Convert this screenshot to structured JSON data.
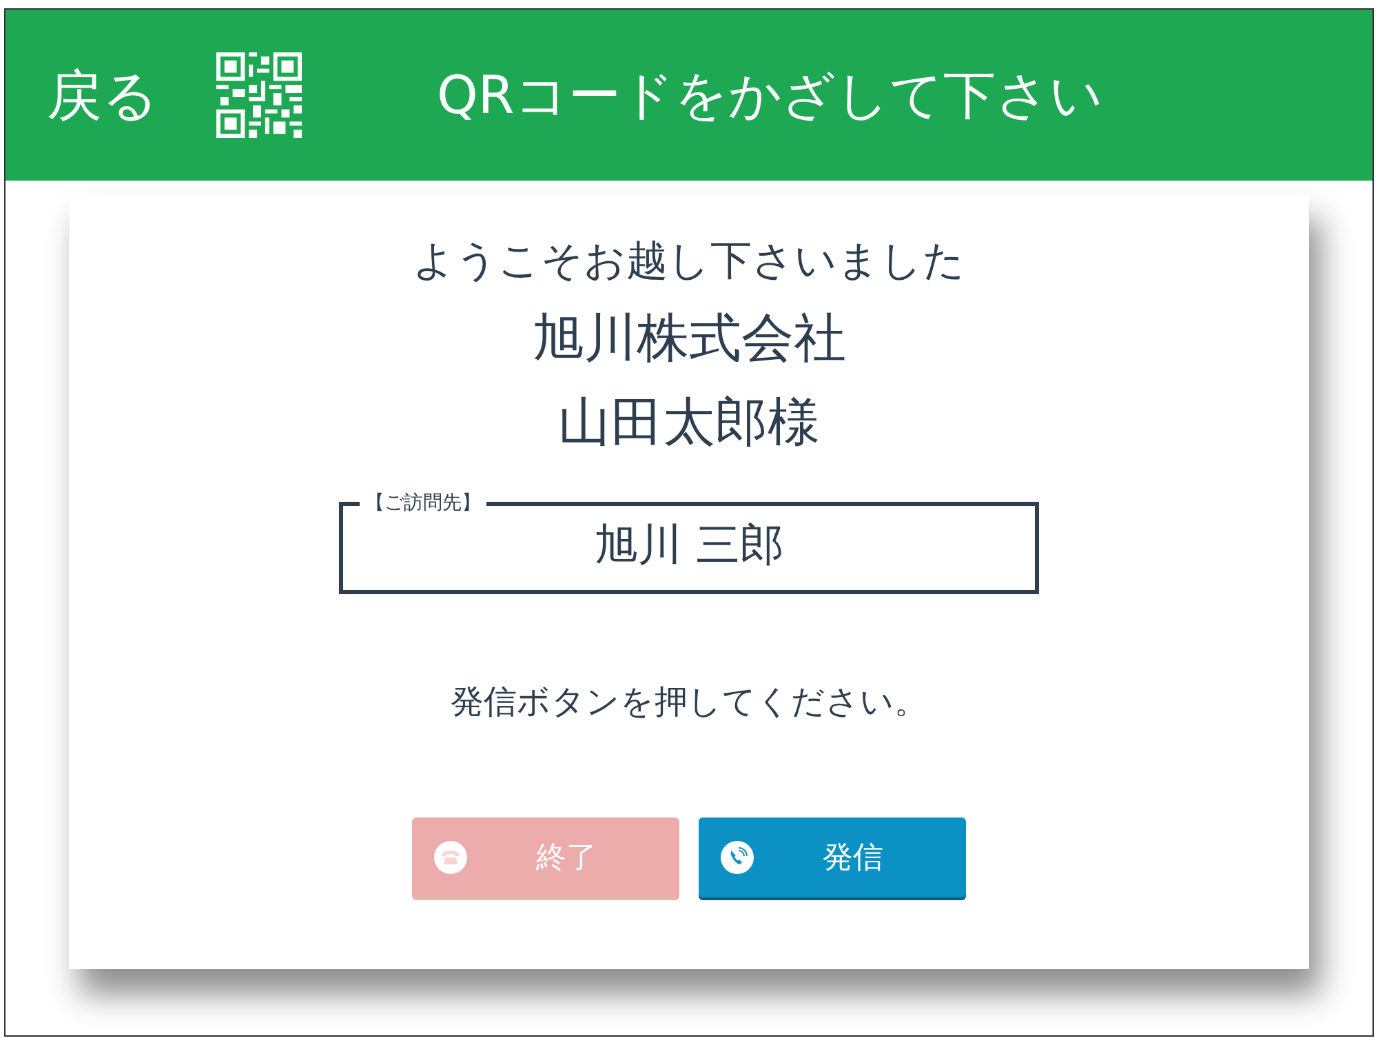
{
  "header": {
    "back_label": "戻る",
    "title": "QRコードをかざして下さい"
  },
  "card": {
    "welcome": "ようこそお越し下さいました",
    "company": "旭川株式会社",
    "guest": "山田太郎様",
    "host_box": {
      "legend": "【ご訪問先】",
      "name": "旭川 三郎"
    },
    "instruction": "発信ボタンを押してください。",
    "buttons": [
      {
        "kind": "end",
        "label": "終了",
        "disabled": true
      },
      {
        "kind": "call",
        "label": "発信",
        "disabled": false
      }
    ]
  }
}
